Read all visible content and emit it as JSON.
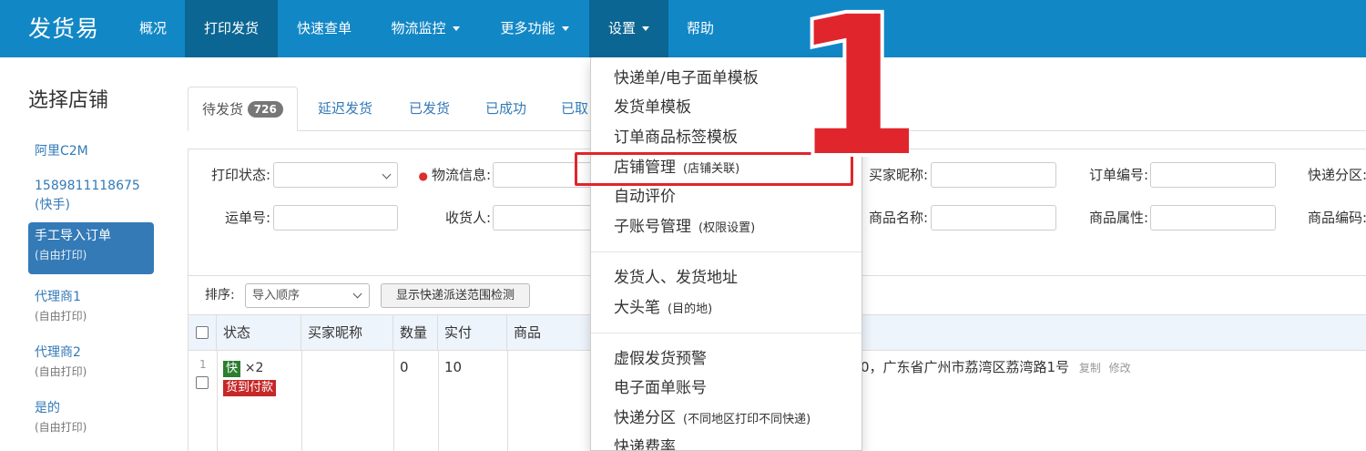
{
  "navbar": {
    "brand": "发货易",
    "items": [
      {
        "label": "概况"
      },
      {
        "label": "打印发货"
      },
      {
        "label": "快速查单"
      },
      {
        "label": "物流监控"
      },
      {
        "label": "更多功能"
      },
      {
        "label": "设置"
      },
      {
        "label": "帮助"
      }
    ]
  },
  "sidebar": {
    "title": "选择店铺",
    "shops": [
      {
        "name": "阿里C2M",
        "sub": ""
      },
      {
        "name": "1589811118675",
        "sub": "(快手)"
      },
      {
        "name": "手工导入订单",
        "sub": "(自由打印)"
      },
      {
        "name": "代理商1",
        "sub": "(自由打印)"
      },
      {
        "name": "代理商2",
        "sub": "(自由打印)"
      },
      {
        "name": "是的",
        "sub": "(自由打印)"
      }
    ]
  },
  "tabs": {
    "items": [
      {
        "label": "待发货",
        "badge": "726"
      },
      {
        "label": "延迟发货"
      },
      {
        "label": "已发货"
      },
      {
        "label": "已成功"
      },
      {
        "label": "已取"
      }
    ]
  },
  "filters": {
    "print_status": "打印状态:",
    "logistics_info": "物流信息:",
    "buyer_nick": "买家昵称:",
    "order_no": "订单编号:",
    "express_zone": "快递分区:",
    "waybill_no": "运单号:",
    "receiver": "收货人:",
    "product_name": "商品名称:",
    "product_attr": "商品属性:",
    "product_code": "商品编码:"
  },
  "sortbar": {
    "label": "排序:",
    "selected": "导入顺序",
    "check_button": "显示快递派送范围检测"
  },
  "table": {
    "headers": [
      "状态",
      "买家昵称",
      "数量",
      "实付",
      "商品"
    ],
    "row": {
      "index": "1",
      "express_tag": "快",
      "count_text": "×2",
      "cod_tag": "货到付款",
      "quantity": "0",
      "paid": "10",
      "address": "0，广东省广州市荔湾区荔湾路1号",
      "copy": "复制",
      "edit": "修改"
    }
  },
  "dropdown": {
    "group1": [
      {
        "label": "快递单/电子面单模板",
        "note": ""
      },
      {
        "label": "发货单模板",
        "note": ""
      },
      {
        "label": "订单商品标签模板",
        "note": ""
      },
      {
        "label": "店铺管理",
        "note": "(店铺关联)"
      },
      {
        "label": "自动评价",
        "note": ""
      },
      {
        "label": "子账号管理",
        "note": "(权限设置)"
      }
    ],
    "group2": [
      {
        "label": "发货人、发货地址",
        "note": ""
      },
      {
        "label": "大头笔",
        "note": "(目的地)"
      }
    ],
    "group3": [
      {
        "label": "虚假发货预警",
        "note": ""
      },
      {
        "label": "电子面单账号",
        "note": ""
      },
      {
        "label": "快递分区",
        "note": "(不同地区打印不同快递)"
      },
      {
        "label": "快递费率",
        "note": ""
      }
    ]
  },
  "annotation": {
    "step_number": "1",
    "color": "#e0262c"
  },
  "colors": {
    "navbar": "#1287c6",
    "navbar_active": "#0b6693",
    "link": "#337ab7",
    "express_tag": "#2e7d32",
    "cod_tag": "#c62828"
  }
}
